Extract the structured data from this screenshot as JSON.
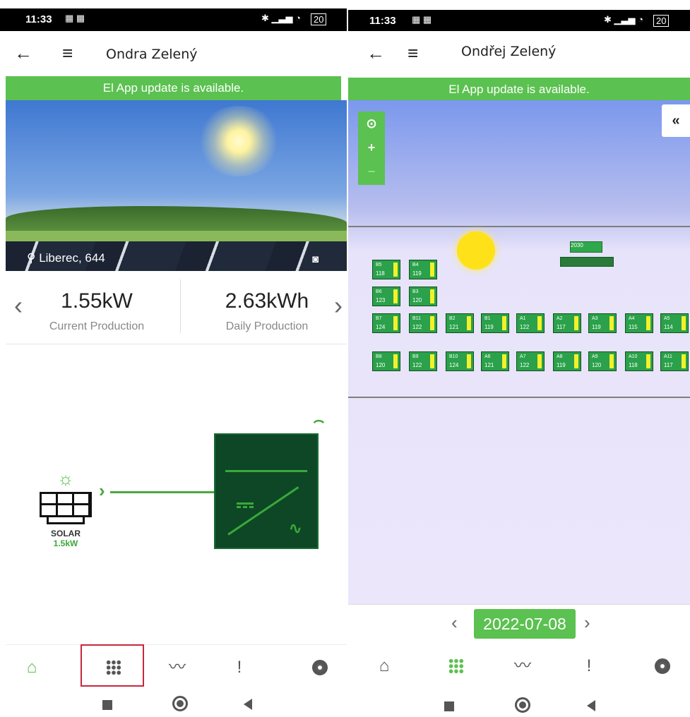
{
  "left": {
    "status": {
      "time": "11:33",
      "icons_left": "☷ ☷",
      "battery": "20"
    },
    "appbar": {
      "title": "Ondra Zelený"
    },
    "banner": "El App update is available.",
    "hero": {
      "location": "Liberec, 644"
    },
    "stats": [
      {
        "value": "1.55kW",
        "label": "Current Production"
      },
      {
        "value": "2.63kWh",
        "label": "Daily Production"
      }
    ],
    "solar": {
      "name": "SOLAR",
      "power": "1.5kW"
    },
    "nav": [
      "home-icon",
      "grid-icon",
      "chart-icon",
      "alert-icon",
      "settings-icon"
    ]
  },
  "right": {
    "status": {
      "time": "11:33",
      "battery": "20"
    },
    "appbar": {
      "title": "Ondřej Zelený"
    },
    "banner": "El App update is available.",
    "map": {
      "collapse": "«",
      "zoom": [
        "⊙",
        "+",
        "−"
      ],
      "modules": [
        {
          "id": "B5",
          "val": "118"
        },
        {
          "id": "B4",
          "val": "119"
        },
        {
          "id": "B6",
          "val": "123"
        },
        {
          "id": "B3",
          "val": "120"
        },
        {
          "id": "B7",
          "val": "124"
        },
        {
          "id": "B11",
          "val": "122"
        },
        {
          "id": "B2",
          "val": "121"
        },
        {
          "id": "B1",
          "val": "119"
        },
        {
          "id": "A1",
          "val": "122"
        },
        {
          "id": "A2",
          "val": "117"
        },
        {
          "id": "A3",
          "val": "119"
        },
        {
          "id": "A4",
          "val": "115"
        },
        {
          "id": "A5",
          "val": "114"
        },
        {
          "id": "B8",
          "val": "120"
        },
        {
          "id": "B9",
          "val": "122"
        },
        {
          "id": "B10",
          "val": "124"
        },
        {
          "id": "A6",
          "val": "121"
        },
        {
          "id": "A7",
          "val": "122"
        },
        {
          "id": "A8",
          "val": "119"
        },
        {
          "id": "A9",
          "val": "120"
        },
        {
          "id": "A10",
          "val": "118"
        },
        {
          "id": "A11",
          "val": "117"
        }
      ],
      "device_label": "2030"
    },
    "date": "2022-07-08"
  }
}
